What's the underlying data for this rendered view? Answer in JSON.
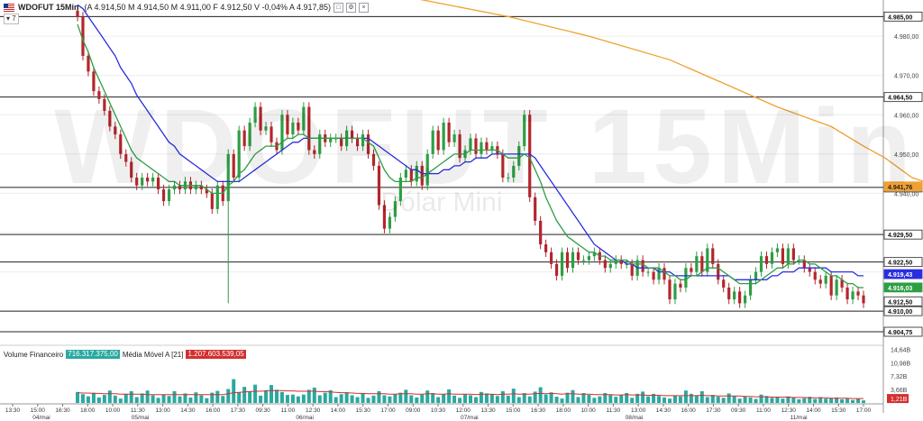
{
  "header": {
    "symbol": "WDOFUT 15Min",
    "ohlc": "(A 4.914,50 M 4.914,50 M 4.911,00 F 4.912,50 V -0,04% A 4.917,85)"
  },
  "indicator_badge": "▾ 7",
  "watermark": {
    "symbol": "WDOFUT 15Min",
    "name": "Dólar Mini"
  },
  "volume_panel": {
    "label": "Volume Financeiro",
    "value": "716.317.375,00",
    "ma_label": "Média Móvel A [21]",
    "ma_value": "1.207.603.539,05"
  },
  "colors": {
    "up": "#2e9e44",
    "down": "#b3262c",
    "ma_short": "#2e9e44",
    "ma_long": "#2a2ee0",
    "ma_slow": "#f0a030",
    "volume": "#2aa9a0",
    "volume_ma": "#d32f2f",
    "current_price": "#2e9e44"
  },
  "chart_data": {
    "type": "candlestick",
    "y_axis": {
      "range": [
        4902,
        4986
      ],
      "ticks": [
        4985,
        4980,
        4970,
        4960,
        4950,
        4940,
        4930,
        4920,
        4910
      ],
      "tick_labels": [
        "4.985,00",
        "4.980,00",
        "4.970,00",
        "4.960,00",
        "4.950,00",
        "4.940,00",
        "4.930,00",
        "4.920,00",
        "4.910,00"
      ]
    },
    "horizontal_lines": [
      {
        "value": 4985.0,
        "label": "4.985,00"
      },
      {
        "value": 4964.5,
        "label": "4.964,50"
      },
      {
        "value": 4941.5,
        "label": "4.941,50"
      },
      {
        "value": 4929.5,
        "label": "4.929,50"
      },
      {
        "value": 4922.5,
        "label": "4.922,50"
      },
      {
        "value": 4910.0,
        "label": "4.910,00"
      },
      {
        "value": 4904.75,
        "label": "4.904,75"
      }
    ],
    "price_tags": [
      {
        "value": 4941.76,
        "label": "4.941,76",
        "color": "#f0a030"
      },
      {
        "value": 4919.43,
        "label": "4.919,43",
        "color": "#2a2ee0"
      },
      {
        "value": 4916.03,
        "label": "4.916,03",
        "color": "#2e9e44"
      },
      {
        "value": 4912.5,
        "label": "4.912,50",
        "color": "#ffffff"
      }
    ],
    "x_time_labels": [
      "13:30",
      "15:00",
      "16:30",
      "18:00",
      "10:00",
      "11:30",
      "13:00",
      "14:30",
      "16:00",
      "17:30",
      "09:30",
      "11:00",
      "12:30",
      "14:00",
      "15:30",
      "17:00",
      "09:00",
      "10:30",
      "12:00",
      "13:30",
      "15:00",
      "16:30",
      "18:00",
      "10:00",
      "11:30",
      "13:00",
      "14:30",
      "16:00",
      "17:30",
      "09:30",
      "11:00",
      "12:30",
      "14:00",
      "15:30",
      "17:00"
    ],
    "x_date_labels": [
      {
        "label": "04/mai",
        "index": 0.3
      },
      {
        "label": "05/mai",
        "index": 0.9
      },
      {
        "label": "06/mai",
        "index": 1.9
      },
      {
        "label": "07/mai",
        "index": 2.9
      },
      {
        "label": "08/mai",
        "index": 3.9
      },
      {
        "label": "11/mai",
        "index": 4.9
      }
    ],
    "closes": [
      4985,
      4975,
      4971,
      4966,
      4964,
      4961,
      4957,
      4955,
      4950,
      4948,
      4944,
      4942,
      4944,
      4943,
      4944,
      4941,
      4938,
      4941,
      4942,
      4941,
      4943,
      4941,
      4942,
      4941,
      4940,
      4936,
      4942,
      4938,
      4950,
      4944,
      4956,
      4952,
      4958,
      4962,
      4956,
      4957,
      4953,
      4951,
      4960,
      4955,
      4958,
      4956,
      4962,
      4951,
      4950,
      4955,
      4953,
      4954,
      4954,
      4952,
      4956,
      4954,
      4952,
      4955,
      4950,
      4947,
      4937,
      4931,
      4934,
      4938,
      4944,
      4946,
      4943,
      4947,
      4942,
      4950,
      4956,
      4951,
      4958,
      4953,
      4955,
      4949,
      4951,
      4954,
      4950,
      4953,
      4951,
      4952,
      4950,
      4944,
      4944,
      4947,
      4952,
      4960,
      4939,
      4933,
      4927,
      4925,
      4922,
      4919,
      4925,
      4921,
      4925,
      4923,
      4923,
      4924,
      4925,
      4923,
      4921,
      4922,
      4923,
      4922,
      4922,
      4919,
      4923,
      4920,
      4920,
      4918,
      4921,
      4918,
      4913,
      4917,
      4916,
      4921,
      4920,
      4924,
      4920,
      4926,
      4922,
      4918,
      4916,
      4913,
      4915,
      4912,
      4914,
      4918,
      4920,
      4924,
      4922,
      4925,
      4926,
      4922,
      4926,
      4923,
      4923,
      4921,
      4920,
      4918,
      4917,
      4919,
      4914,
      4918,
      4916,
      4913,
      4915,
      4914,
      4912
    ],
    "ma_short": {
      "name": "",
      "values": [
        4983,
        4979,
        4976,
        4972,
        4969,
        4966,
        4963,
        4960,
        4957,
        4954,
        4951,
        4949,
        4948,
        4947,
        4946,
        4945,
        4944,
        4943,
        4943,
        4942,
        4942,
        4942,
        4942,
        4942,
        4941,
        4940,
        4940,
        4940,
        4942,
        4943,
        4945,
        4946,
        4948,
        4950,
        4951,
        4952,
        4952,
        4952,
        4953,
        4954,
        4954,
        4955,
        4955,
        4954,
        4954,
        4954,
        4954,
        4954,
        4954,
        4954,
        4954,
        4954,
        4954,
        4954,
        4953,
        4952,
        4949,
        4946,
        4944,
        4943,
        4943,
        4943,
        4943,
        4944,
        4944,
        4945,
        4946,
        4947,
        4948,
        4949,
        4950,
        4950,
        4950,
        4951,
        4951,
        4951,
        4951,
        4951,
        4951,
        4950,
        4949,
        4949,
        4949,
        4950,
        4949,
        4946,
        4943,
        4939,
        4936,
        4933,
        4931,
        4929,
        4928,
        4927,
        4926,
        4925,
        4925,
        4924,
        4924,
        4923,
        4923,
        4923,
        4923,
        4922,
        4922,
        4922,
        4921,
        4921,
        4921,
        4920,
        4919,
        4919,
        4918,
        4918,
        4919,
        4919,
        4920,
        4921,
        4921,
        4921,
        4920,
        4919,
        4918,
        4917,
        4917,
        4917,
        4917,
        4918,
        4919,
        4920,
        4921,
        4921,
        4922,
        4922,
        4923,
        4923,
        4922,
        4922,
        4921,
        4920,
        4919,
        4919,
        4918,
        4917,
        4917,
        4916,
        4916
      ]
    },
    "ma_long": {
      "name": "",
      "values": [
        4988,
        4987,
        4985,
        4983,
        4981,
        4979,
        4977,
        4975,
        4972,
        4970,
        4968,
        4965,
        4963,
        4961,
        4959,
        4957,
        4955,
        4953,
        4952,
        4950,
        4949,
        4948,
        4947,
        4946,
        4945,
        4944,
        4943,
        4943,
        4943,
        4943,
        4943,
        4944,
        4945,
        4946,
        4947,
        4948,
        4949,
        4950,
        4951,
        4952,
        4953,
        4953,
        4954,
        4954,
        4954,
        4954,
        4954,
        4954,
        4954,
        4954,
        4954,
        4954,
        4954,
        4954,
        4954,
        4953,
        4952,
        4951,
        4950,
        4949,
        4948,
        4947,
        4946,
        4946,
        4945,
        4945,
        4945,
        4945,
        4946,
        4946,
        4947,
        4947,
        4948,
        4948,
        4949,
        4949,
        4949,
        4950,
        4950,
        4950,
        4950,
        4950,
        4950,
        4950,
        4950,
        4949,
        4947,
        4945,
        4943,
        4941,
        4939,
        4937,
        4935,
        4933,
        4931,
        4929,
        4927,
        4926,
        4925,
        4924,
        4923,
        4923,
        4922,
        4922,
        4921,
        4921,
        4921,
        4921,
        4920,
        4920,
        4920,
        4919,
        4919,
        4919,
        4919,
        4919,
        4919,
        4919,
        4919,
        4919,
        4919,
        4919,
        4918,
        4918,
        4918,
        4918,
        4918,
        4918,
        4918,
        4919,
        4919,
        4920,
        4920,
        4920,
        4921,
        4921,
        4921,
        4921,
        4921,
        4921,
        4920,
        4920,
        4920,
        4920,
        4920,
        4919,
        4919
      ]
    },
    "ma_slow": {
      "name": "",
      "points": [
        [
          0,
          5015
        ],
        [
          30,
          5002
        ],
        [
          50,
          4993
        ],
        [
          80,
          4985
        ],
        [
          95,
          4980
        ],
        [
          110,
          4974
        ],
        [
          120,
          4968
        ],
        [
          130,
          4962
        ],
        [
          140,
          4957
        ],
        [
          146,
          4952
        ],
        [
          150,
          4949
        ],
        [
          155,
          4944
        ],
        [
          160,
          4941.76
        ]
      ]
    },
    "volume": {
      "y_axis": {
        "ticks": [
          14.64,
          10.98,
          7.32,
          3.66,
          1.21
        ],
        "tick_labels": [
          "14,64B",
          "10,98B",
          "7,32B",
          "3,66B",
          "1,21B"
        ],
        "range": [
          0,
          15.5
        ]
      },
      "values": [
        3.0,
        2.4,
        1.8,
        2.8,
        1.5,
        2.2,
        3.4,
        2.0,
        1.2,
        2.5,
        3.2,
        1.6,
        2.6,
        3.4,
        2.1,
        1.4,
        2.3,
        1.9,
        3.2,
        1.8,
        2.6,
        1.5,
        2.9,
        2.1,
        1.3,
        2.8,
        3.3,
        1.9,
        3.8,
        6.5,
        2.9,
        4.4,
        3.1,
        5.0,
        2.0,
        3.5,
        4.9,
        3.6,
        3.0,
        2.2,
        2.3,
        1.8,
        2.3,
        3.6,
        4.2,
        2.1,
        2.8,
        3.5,
        1.6,
        2.4,
        2.9,
        2.1,
        1.6,
        2.7,
        1.4,
        2.0,
        3.2,
        2.1,
        1.8,
        2.4,
        2.8,
        3.6,
        2.1,
        1.5,
        2.3,
        3.4,
        2.7,
        1.6,
        2.4,
        3.7,
        2.0,
        1.4,
        2.3,
        2.1,
        1.6,
        3.0,
        2.6,
        2.4,
        1.9,
        3.2,
        2.0,
        3.9,
        1.6,
        2.7,
        1.8,
        3.1,
        4.3,
        2.3,
        2.9,
        1.7,
        1.2,
        2.8,
        3.5,
        1.6,
        2.7,
        2.2,
        1.4,
        1.8,
        2.7,
        2.3,
        1.7,
        2.1,
        2.7,
        1.4,
        2.5,
        3.1,
        1.8,
        2.5,
        1.9,
        1.5,
        1.2,
        2.0,
        1.8,
        3.4,
        2.5,
        2.1,
        3.2,
        1.6,
        2.2,
        1.7,
        1.4,
        2.6,
        1.9,
        1.2,
        1.8,
        1.5,
        1.1,
        2.3,
        1.9,
        1.4,
        1.7,
        1.2,
        1.8,
        1.5,
        1.0,
        1.3,
        1.7,
        1.1,
        1.6,
        1.2,
        1.3,
        1.5,
        1.0,
        1.2,
        0.8,
        1.1,
        0.7
      ],
      "ma_values": [
        2.8,
        2.7,
        2.7,
        2.6,
        2.6,
        2.5,
        2.5,
        2.5,
        2.4,
        2.4,
        2.4,
        2.4,
        2.4,
        2.3,
        2.3,
        2.3,
        2.3,
        2.3,
        2.3,
        2.3,
        2.3,
        2.3,
        2.3,
        2.3,
        2.3,
        2.3,
        2.3,
        2.3,
        2.5,
        2.8,
        2.9,
        3.0,
        3.1,
        3.2,
        3.2,
        3.3,
        3.4,
        3.4,
        3.4,
        3.3,
        3.3,
        3.2,
        3.2,
        3.2,
        3.2,
        3.1,
        3.1,
        3.0,
        2.9,
        2.8,
        2.8,
        2.7,
        2.6,
        2.6,
        2.5,
        2.5,
        2.5,
        2.5,
        2.4,
        2.4,
        2.5,
        2.5,
        2.5,
        2.4,
        2.4,
        2.5,
        2.5,
        2.4,
        2.4,
        2.5,
        2.4,
        2.4,
        2.4,
        2.4,
        2.3,
        2.4,
        2.4,
        2.4,
        2.3,
        2.4,
        2.4,
        2.5,
        2.4,
        2.4,
        2.4,
        2.5,
        2.6,
        2.5,
        2.6,
        2.5,
        2.4,
        2.5,
        2.5,
        2.4,
        2.4,
        2.4,
        2.3,
        2.3,
        2.3,
        2.3,
        2.2,
        2.2,
        2.3,
        2.2,
        2.2,
        2.2,
        2.1,
        2.1,
        2.1,
        2.0,
        2.0,
        2.0,
        2.0,
        2.0,
        2.0,
        2.0,
        2.1,
        2.0,
        2.0,
        1.9,
        1.9,
        1.9,
        1.9,
        1.9,
        1.8,
        1.8,
        1.7,
        1.7,
        1.7,
        1.6,
        1.6,
        1.6,
        1.6,
        1.5,
        1.5,
        1.5,
        1.4,
        1.4,
        1.4,
        1.4,
        1.3,
        1.3,
        1.3,
        1.3,
        1.2,
        1.2,
        1.2
      ]
    }
  }
}
